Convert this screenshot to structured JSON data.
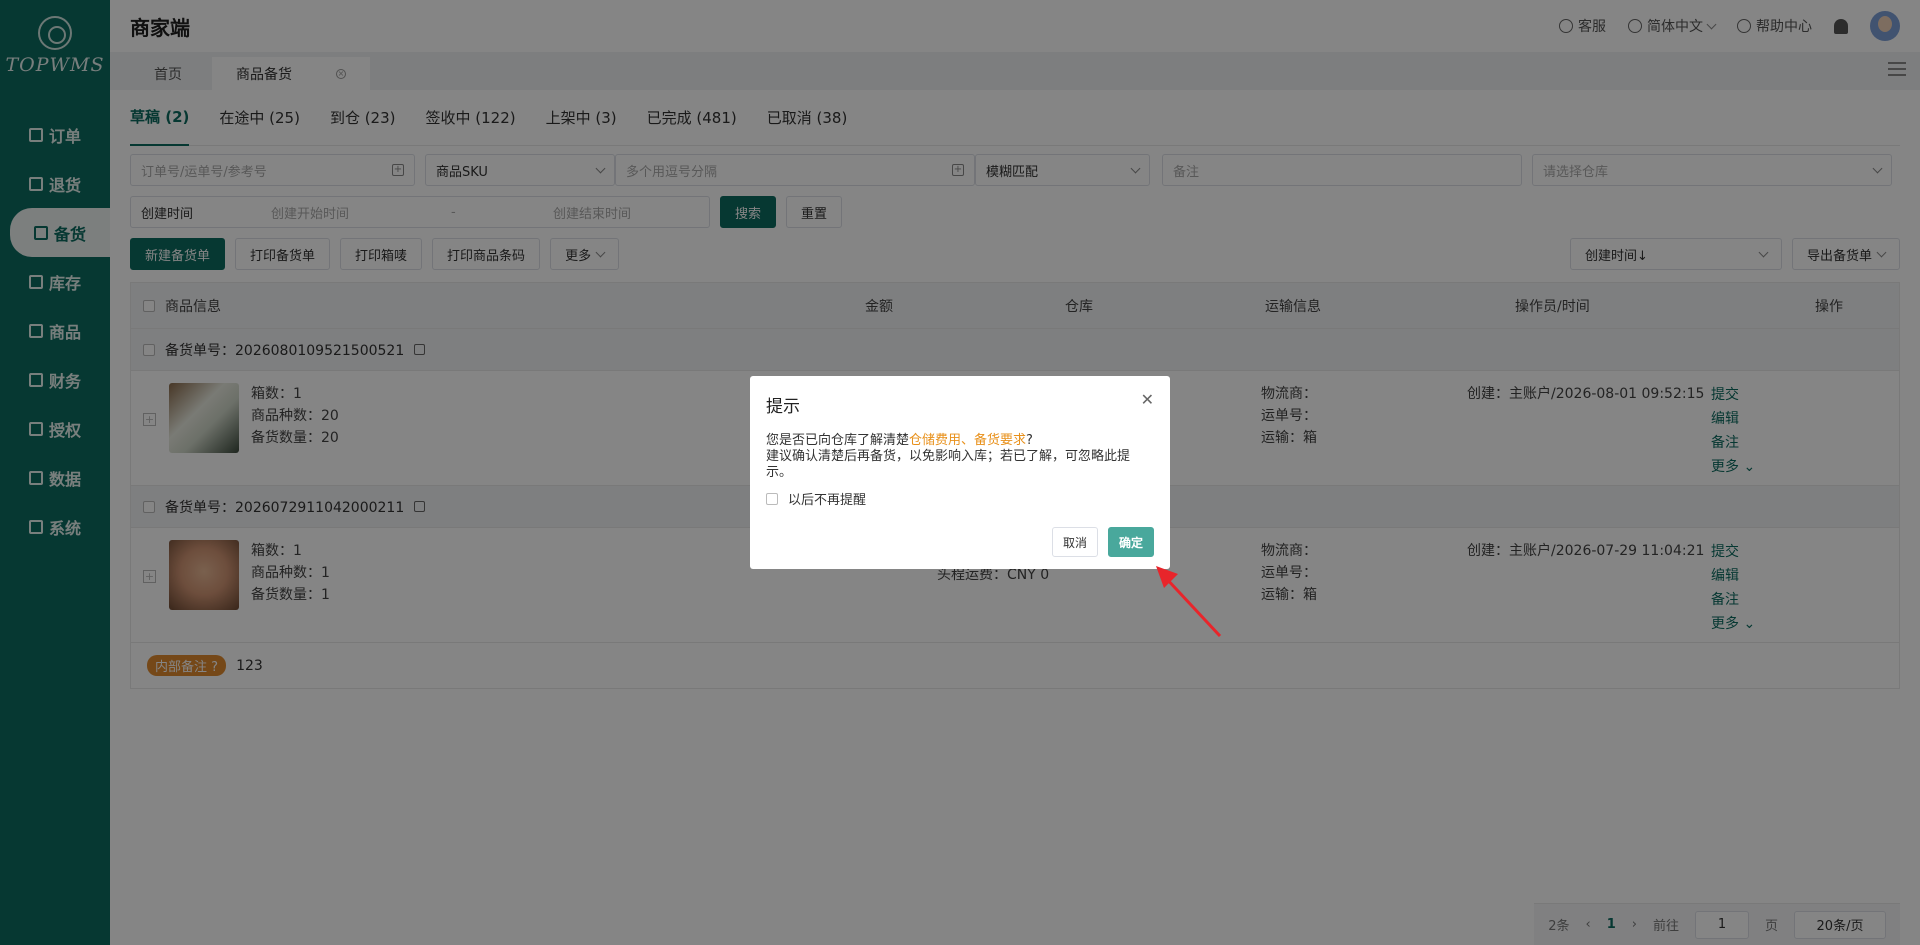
{
  "app": {
    "logo_text": "TOPWMS",
    "title": "商家端"
  },
  "sidebar": {
    "items": [
      {
        "label": "订单",
        "icon": "order-icon"
      },
      {
        "label": "退货",
        "icon": "return-icon"
      },
      {
        "label": "备货",
        "icon": "stock-prep-icon",
        "active": true
      },
      {
        "label": "库存",
        "icon": "inventory-icon"
      },
      {
        "label": "商品",
        "icon": "goods-icon"
      },
      {
        "label": "财务",
        "icon": "finance-icon"
      },
      {
        "label": "授权",
        "icon": "auth-icon"
      },
      {
        "label": "数据",
        "icon": "data-icon"
      },
      {
        "label": "系统",
        "icon": "system-icon"
      }
    ]
  },
  "topbar": {
    "service": "客服",
    "language": "简体中文",
    "help": "帮助中心"
  },
  "page_tabs": [
    {
      "label": "首页"
    },
    {
      "label": "商品备货"
    }
  ],
  "status_tabs": [
    "草稿 (2)",
    "在途中 (25)",
    "到仓 (23)",
    "签收中 (122)",
    "上架中 (3)",
    "已完成 (481)",
    "已取消 (38)"
  ],
  "filters": {
    "order_placeholder": "订单号/运单号/参考号",
    "sku_select": "商品SKU",
    "multi_placeholder": "多个用逗号分隔",
    "match_select": "模糊匹配",
    "remark_placeholder": "备注",
    "warehouse_placeholder": "请选择仓库",
    "time_type": "创建时间",
    "start_placeholder": "创建开始时间",
    "range_sep": "-",
    "end_placeholder": "创建结束时间",
    "search": "搜索",
    "reset": "重置"
  },
  "toolbar": {
    "new": "新建备货单",
    "print_order": "打印备货单",
    "print_box": "打印箱唛",
    "print_barcode": "打印商品条码",
    "more": "更多",
    "sort": "创建时间↓",
    "export": "导出备货单"
  },
  "table": {
    "headers": [
      "商品信息",
      "金额",
      "仓库",
      "运输信息",
      "操作员/时间",
      "操作"
    ],
    "groups": [
      {
        "order_no": "备货单号：2026080109521500521",
        "boxes": "箱数：1",
        "kinds": "商品种数：20",
        "qty": "备货数量：20",
        "fee": "",
        "carrier": "物流商：",
        "tracking": "运单号：",
        "transport": "运输：箱",
        "created": "创建：主账户/2026-08-01 09:52:15",
        "actions": [
          "提交",
          "编辑",
          "备注",
          "更多"
        ]
      },
      {
        "order_no": "备货单号：2026072911042000211",
        "boxes": "箱数：1",
        "kinds": "商品种数：1",
        "qty": "备货数量：1",
        "fee": "头程运费：CNY 0",
        "carrier": "物流商：",
        "tracking": "运单号：",
        "transport": "运输：箱",
        "created": "创建：主账户/2026-07-29 11:04:21",
        "actions": [
          "提交",
          "编辑",
          "备注",
          "更多"
        ]
      }
    ],
    "remark_tag": "内部备注",
    "remark_value": "123"
  },
  "pager": {
    "total": "2条",
    "current": "1",
    "goto": "前往",
    "page_input": "1",
    "page_unit": "页",
    "size": "20条/页"
  },
  "dialog": {
    "title": "提示",
    "line1_pre": "您是否已向仓库了解清楚",
    "line1_highlight": "仓储费用、备货要求",
    "line1_post": "?",
    "line2": "建议确认清楚后再备货，以免影响入库；若已了解，可忽略此提示。",
    "checkbox_label": "以后不再提醒",
    "cancel": "取消",
    "confirm": "确定"
  },
  "colors": {
    "brand": "#0d6b60",
    "highlight": "#e8901a",
    "confirm": "#49a89c",
    "arrow": "#e8252b"
  }
}
